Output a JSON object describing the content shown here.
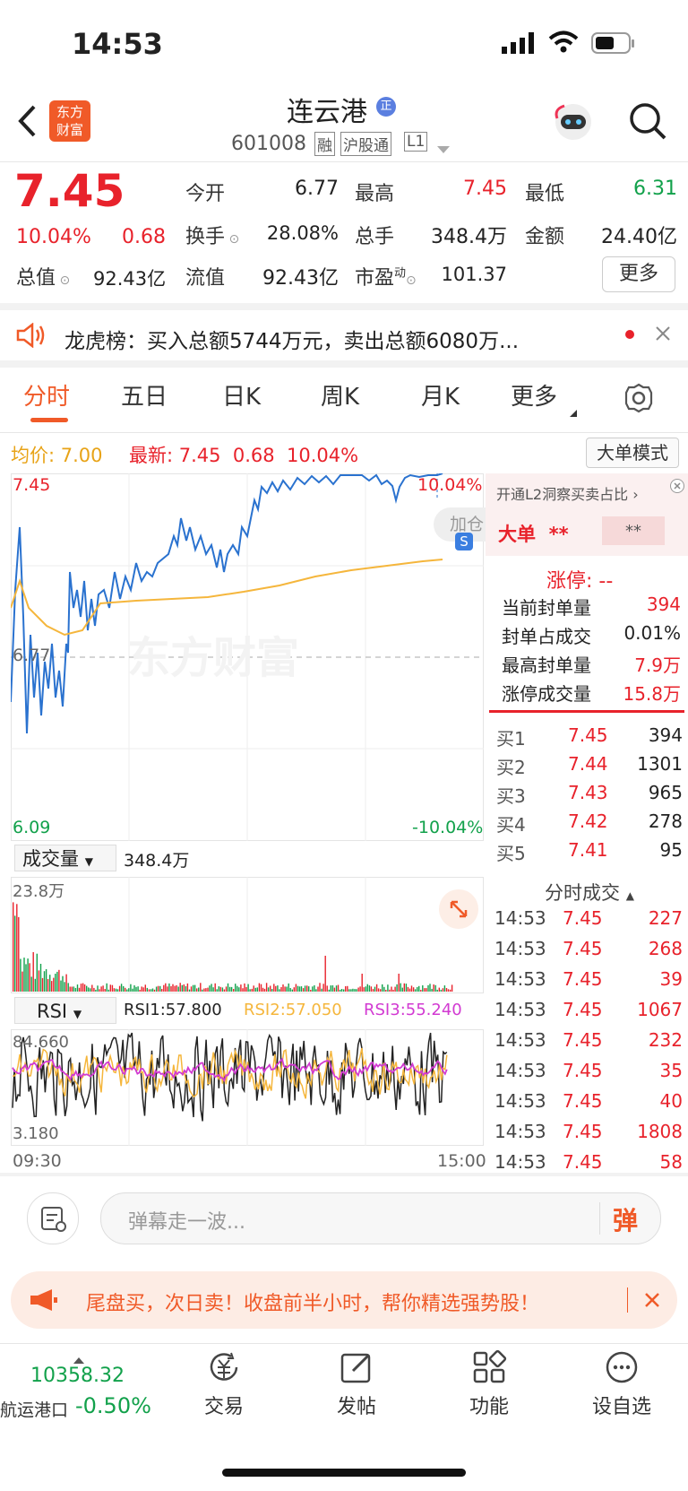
{
  "status_bar": {
    "time": "14:53"
  },
  "header": {
    "logo_line1": "东方",
    "logo_line2": "财富",
    "title": "连云港",
    "badge": "正",
    "code": "601008",
    "tags": [
      "融",
      "沪股通",
      "L1"
    ]
  },
  "quote": {
    "price": "7.45",
    "change_pct": "10.04%",
    "change": "0.68",
    "open_label": "今开",
    "open": "6.77",
    "high_label": "最高",
    "high": "7.45",
    "low_label": "最低",
    "low": "6.31",
    "turnover_label": "换手",
    "turnover": "28.08%",
    "vol_label": "总手",
    "vol": "348.4万",
    "amount_label": "金额",
    "amount": "24.40亿",
    "mktcap_label": "总值",
    "mktcap": "92.43亿",
    "float_label": "流值",
    "float": "92.43亿",
    "pe_label": "市盈",
    "pe_sup": "动",
    "pe": "101.37",
    "more": "更多"
  },
  "notice": {
    "text": "龙虎榜：买入总额5744万元，卖出总额6080万..."
  },
  "tabs": [
    "分时",
    "五日",
    "日K",
    "周K",
    "月K",
    "更多"
  ],
  "chart_header": {
    "avg_label": "均价:",
    "avg": "7.00",
    "latest_label": "最新:",
    "latest": "7.45",
    "chg": "0.68",
    "pct": "10.04%",
    "mode_btn": "大单模式"
  },
  "price_axis": {
    "top": "7.45",
    "top_pct": "10.04%",
    "mid": "6.77",
    "bottom": "6.09",
    "bottom_pct": "-10.04%"
  },
  "volume_panel": {
    "selector": "成交量",
    "total": "348.4万",
    "max": "23.8万"
  },
  "rsi_panel": {
    "selector": "RSI",
    "rsi1": "RSI1:57.800",
    "rsi2": "RSI2:57.050",
    "rsi3": "RSI3:55.240",
    "top": "84.660",
    "bottom": "3.180"
  },
  "time_axis": {
    "start": "09:30",
    "end": "15:00"
  },
  "add_watch": "加仓",
  "side_panel": {
    "l2_banner": "开通L2洞察买卖占比",
    "big_order": "大单",
    "big_buy": "**",
    "big_sell": "**",
    "limit_title": "涨停: --",
    "limit_rows": [
      {
        "label": "当前封单量",
        "value": "394"
      },
      {
        "label": "封单占成交",
        "value": "0.01%"
      },
      {
        "label": "最高封单量",
        "value": "7.9万"
      },
      {
        "label": "涨停成交量",
        "value": "15.8万"
      }
    ],
    "bids": [
      {
        "label": "买1",
        "price": "7.45",
        "vol": "394"
      },
      {
        "label": "买2",
        "price": "7.44",
        "vol": "1301"
      },
      {
        "label": "买3",
        "price": "7.43",
        "vol": "965"
      },
      {
        "label": "买4",
        "price": "7.42",
        "vol": "278"
      },
      {
        "label": "买5",
        "price": "7.41",
        "vol": "95"
      }
    ],
    "ticks_title": "分时成交",
    "ticks": [
      {
        "time": "14:53",
        "price": "7.45",
        "vol": "227"
      },
      {
        "time": "14:53",
        "price": "7.45",
        "vol": "268"
      },
      {
        "time": "14:53",
        "price": "7.45",
        "vol": "39"
      },
      {
        "time": "14:53",
        "price": "7.45",
        "vol": "1067"
      },
      {
        "time": "14:53",
        "price": "7.45",
        "vol": "232"
      },
      {
        "time": "14:53",
        "price": "7.45",
        "vol": "35"
      },
      {
        "time": "14:53",
        "price": "7.45",
        "vol": "40"
      },
      {
        "time": "14:53",
        "price": "7.45",
        "vol": "1808"
      },
      {
        "time": "14:53",
        "price": "7.45",
        "vol": "58"
      }
    ]
  },
  "comment": {
    "placeholder": "弹幕走一波...",
    "send": "弹"
  },
  "promo": {
    "text": "尾盘买，次日卖！收盘前半小时，帮你精选强势股！"
  },
  "bottom_nav": {
    "index_value": "10358.32",
    "index_name": "航运港口",
    "index_change": "-0.50%",
    "trade": "交易",
    "post": "发帖",
    "func": "功能",
    "watch": "设自选"
  },
  "chart_data": {
    "type": "line",
    "x": [
      "09:30",
      "15:00"
    ],
    "ylim": [
      6.09,
      7.45
    ],
    "series": []
  }
}
